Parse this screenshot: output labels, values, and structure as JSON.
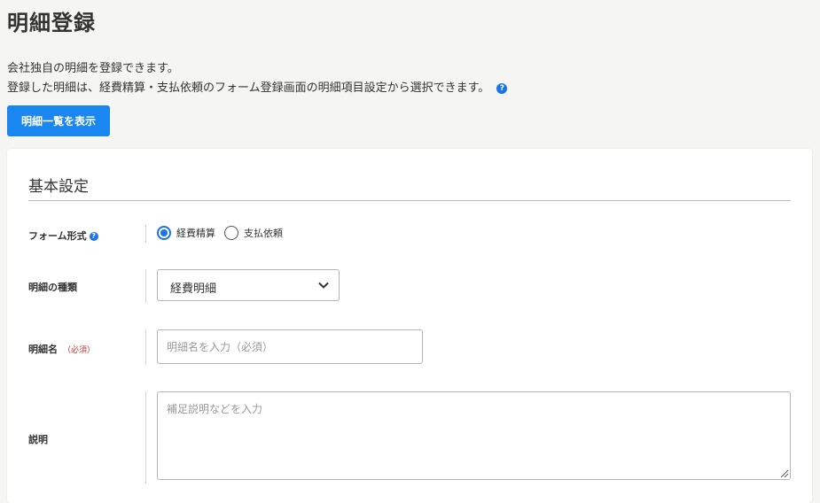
{
  "page": {
    "title": "明細登録",
    "description_line1": "会社独自の明細を登録できます。",
    "description_line2": "登録した明細は、経費精算・支払依頼のフォーム登録画面の明細項目設定から選択できます。",
    "help_glyph": "?"
  },
  "toolbar": {
    "list_button_label": "明細一覧を表示"
  },
  "basic_settings": {
    "section_title": "基本設定",
    "form_type": {
      "label": "フォーム形式",
      "help_glyph": "?",
      "options": [
        {
          "label": "経費精算",
          "selected": true
        },
        {
          "label": "支払依頼",
          "selected": false
        }
      ]
    },
    "detail_kind": {
      "label": "明細の種類",
      "selected_value": "経費明細",
      "icon": "chevron-down-icon"
    },
    "detail_name": {
      "label": "明細名",
      "required_label": "（必須）",
      "placeholder": "明細名を入力（必須）",
      "value": ""
    },
    "description": {
      "label": "説明",
      "placeholder": "補足説明などを入力",
      "value": ""
    }
  },
  "colors": {
    "accent": "#1a86f0",
    "required": "#c0392b",
    "background": "#f5f5f3"
  }
}
